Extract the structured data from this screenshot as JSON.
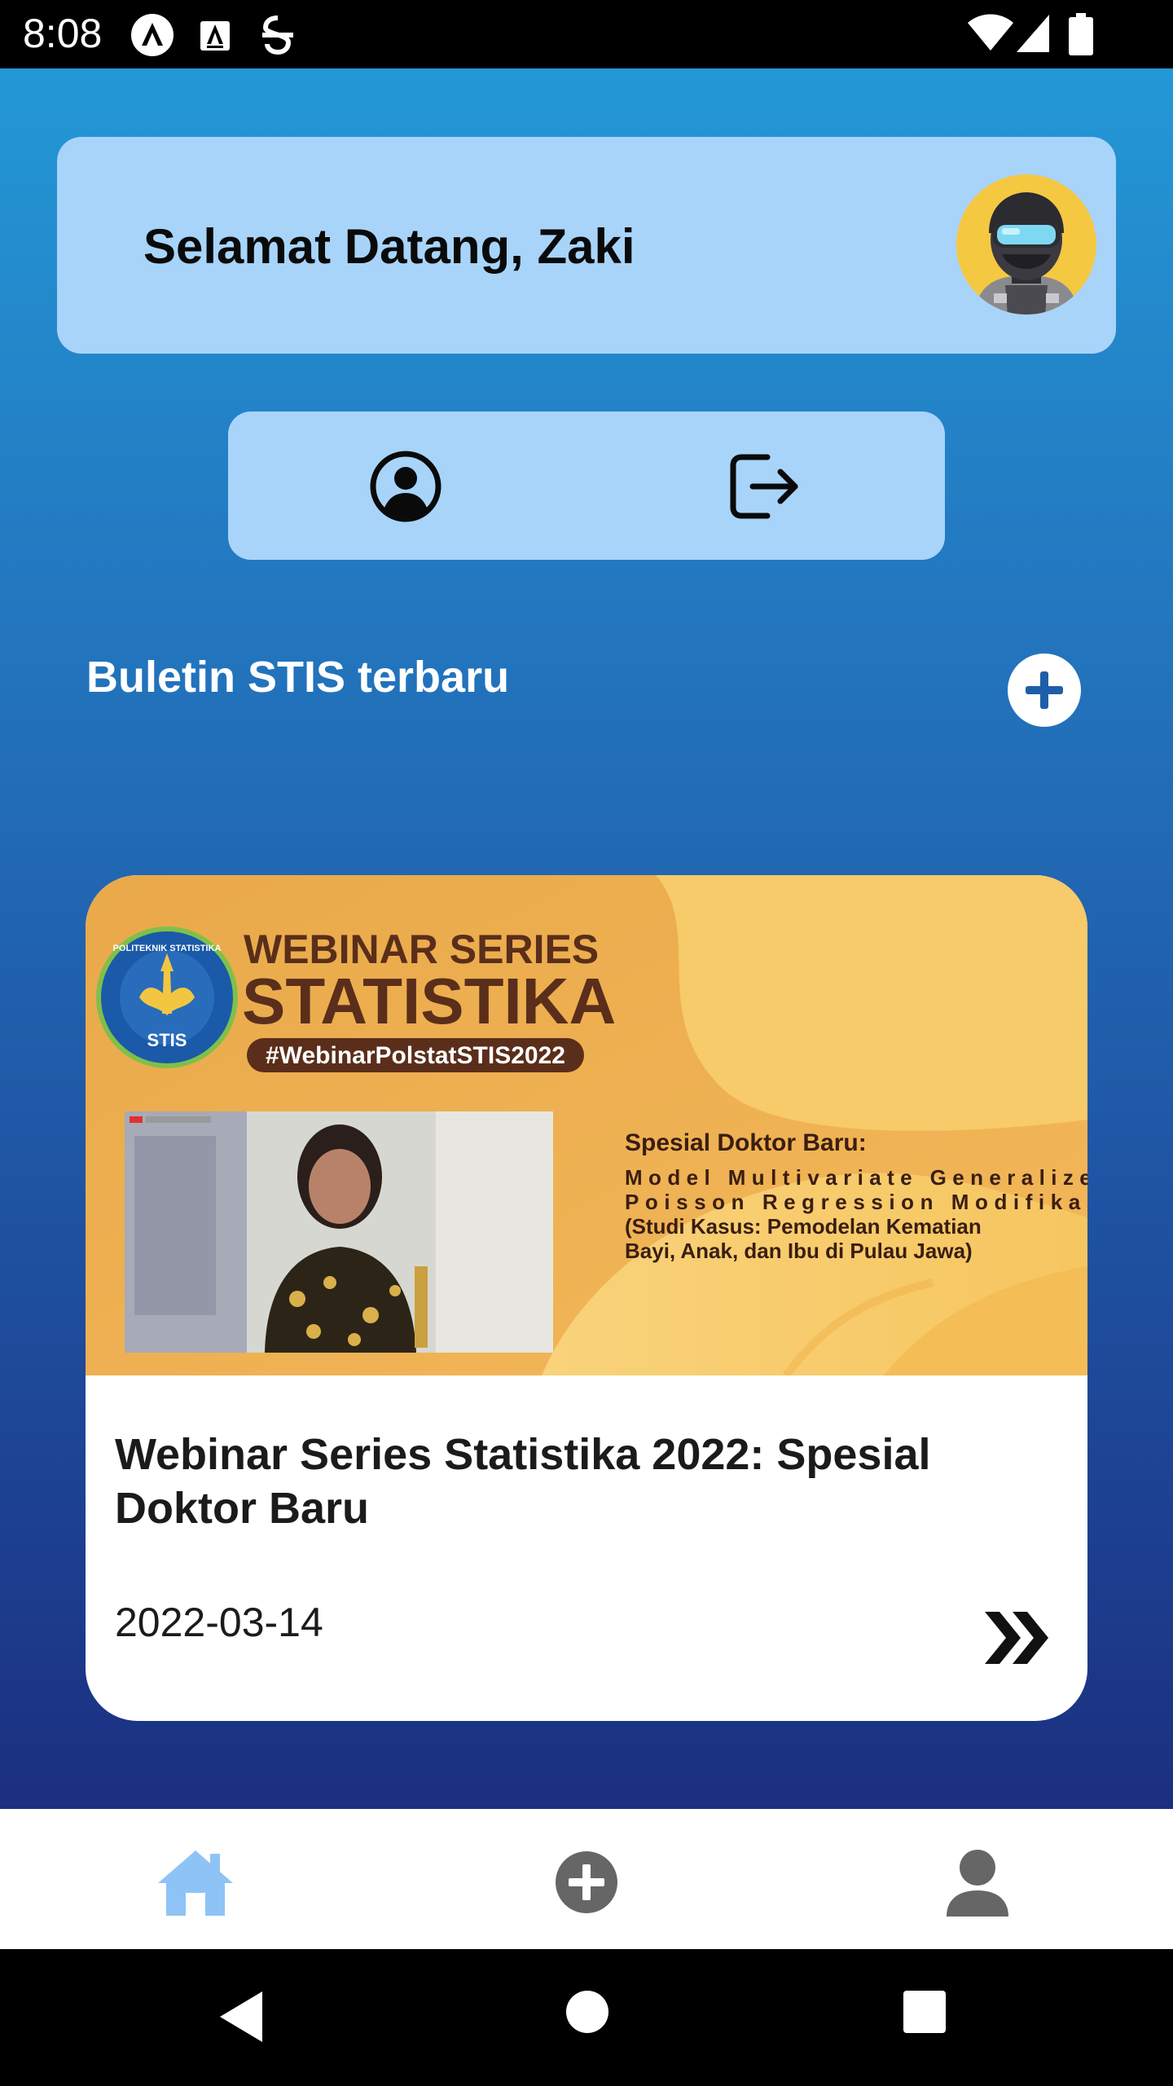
{
  "status_bar": {
    "time": "8:08",
    "icons": [
      "notification-a-icon",
      "notification-text-icon",
      "notification-s-icon",
      "wifi-icon",
      "cellular-signal-icon",
      "battery-icon"
    ]
  },
  "header": {
    "welcome": "Selamat Datang, Zaki",
    "avatar_icon": "user-avatar-goggles"
  },
  "actions": {
    "profile_icon": "account-circle-icon",
    "logout_icon": "logout-icon"
  },
  "section": {
    "title": "Buletin STIS terbaru",
    "add_icon": "add-circle-icon"
  },
  "news": {
    "banner": {
      "logo_ring_text": "POLITEKNIK STATISTIKA",
      "logo_text": "STIS",
      "series_line1": "WEBINAR SERIES",
      "series_line2": "STATISTIKA",
      "hashtag": "#WebinarPolstatSTIS2022",
      "special_heading": "Spesial Doktor Baru:",
      "topic_line1": "Model Multivariate Generalized",
      "topic_line2": "Poisson Regression Modifikasi",
      "topic_line3": "(Studi Kasus: Pemodelan Kematian",
      "topic_line4": "Bayi, Anak, dan Ibu di Pulau Jawa)"
    },
    "title": "Webinar Series Statistika 2022: Spesial Doktor Baru",
    "date": "2022-03-14",
    "more_icon": "double-chevron-right-icon"
  },
  "bottom_nav": {
    "items": [
      "home-icon",
      "add-circle-icon",
      "person-icon"
    ],
    "active_index": 0,
    "active_color": "#8ec4f5",
    "inactive_color": "#666666"
  },
  "colors": {
    "card_bg": "#a8d4fa",
    "gradient_top": "#2398d6",
    "gradient_bottom": "#1c2f80"
  }
}
